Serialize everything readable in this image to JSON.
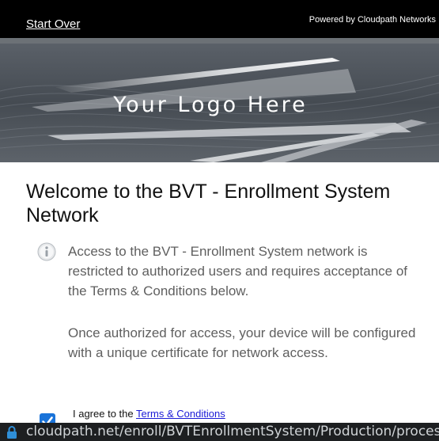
{
  "header": {
    "start_over_label": "Start Over",
    "powered_by": "Powered by Cloudpath Networks"
  },
  "banner": {
    "logo_text": "Your Logo Here"
  },
  "main": {
    "title": "Welcome to the BVT - Enrollment System Network",
    "info_icon": "info-icon",
    "paragraph1": "Access to the BVT - Enrollment System network is restricted to authorized users and requires acceptance of the Terms & Conditions below.",
    "paragraph2": "Once authorized for access, your device will be configured with a unique certificate for network access."
  },
  "agreement": {
    "checked": true,
    "label_prefix": "I agree to the ",
    "link_text": "Terms & Conditions"
  },
  "status_bar": {
    "lock_icon": "lock-icon",
    "url": "cloudpath.net/enroll/BVTEnrollmentSystem/Production/process"
  },
  "colors": {
    "topbar": "#000000",
    "checkbox": "#1a73d9",
    "link": "#1a1ad6",
    "lock": "#2f8fd8"
  }
}
